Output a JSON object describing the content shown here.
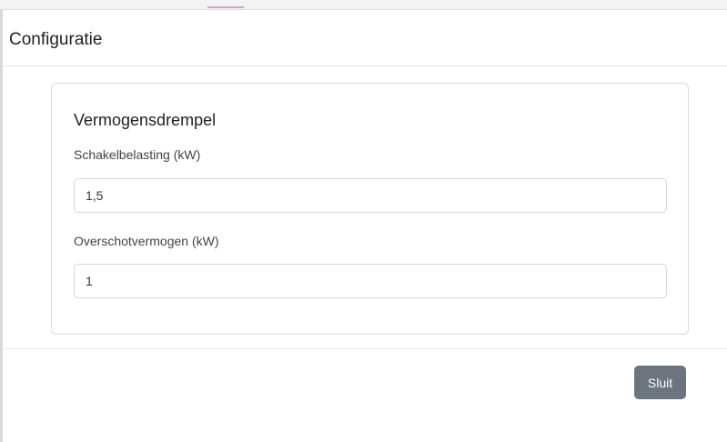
{
  "dialog": {
    "title": "Configuratie",
    "section": {
      "title": "Vermogensdrempel",
      "fields": [
        {
          "label": "Schakelbelasting (kW)",
          "value": "1,5"
        },
        {
          "label": "Overschotvermogen (kW)",
          "value": "1"
        }
      ]
    },
    "close_label": "Sluit"
  },
  "colors": {
    "button_bg": "#6c757d",
    "button_text": "#ffffff",
    "border": "#dcdcdc"
  }
}
